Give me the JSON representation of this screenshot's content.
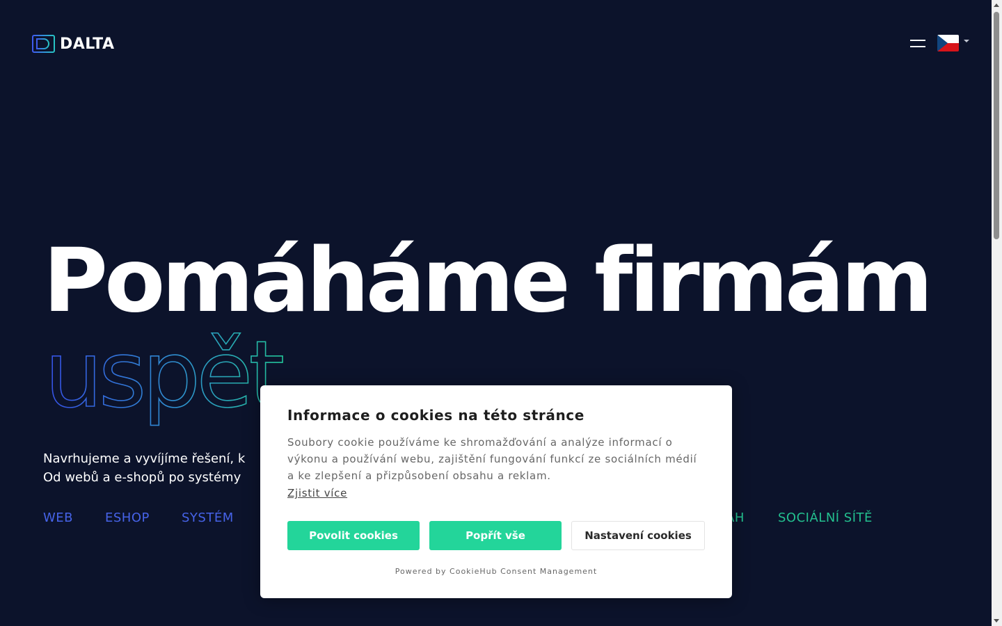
{
  "header": {
    "logo_text": "DALTA",
    "menu_icon": "hamburger-menu-icon",
    "language_icon": "czech-flag-icon"
  },
  "hero": {
    "title": "Pomáháme firmám",
    "outline_word": "uspět",
    "description_line1": "Navrhujeme a vyvíjíme řešení, k",
    "description_line2": "Od webů a e-shopů po systémy"
  },
  "services": [
    {
      "label": "WEB",
      "color": "#4663e8"
    },
    {
      "label": "ESHOP",
      "color": "#4663e8"
    },
    {
      "label": "SYSTÉM",
      "color": "#4663e8"
    },
    {
      "label": "AH",
      "color": "#23c08f"
    },
    {
      "label": "SOCIÁLNÍ SÍTĚ",
      "color": "#23c08f"
    }
  ],
  "cookie": {
    "title": "Informace o cookies na této stránce",
    "text": "Soubory cookie používáme ke shromažďování a analýze informací o výkonu a používání webu, zajištění fungování funkcí ze sociálních médií a ke zlepšení a přizpůsobení obsahu a reklam.",
    "learn_more": "Zjistit více",
    "allow_label": "Povolit cookies",
    "deny_label": "Popřít vše",
    "settings_label": "Nastavení cookies",
    "powered_by": "Powered by CookieHub Consent Management"
  },
  "colors": {
    "background": "#0c132b",
    "accent_blue": "#4663e8",
    "accent_green": "#23d59a"
  }
}
